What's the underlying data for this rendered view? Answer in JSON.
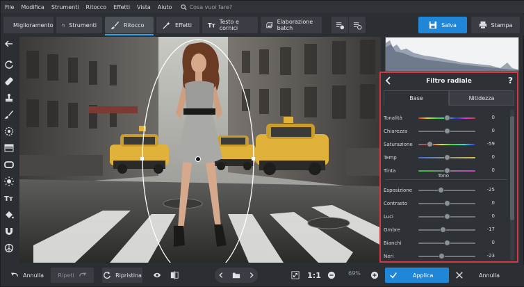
{
  "menu": [
    "File",
    "Modifica",
    "Strumenti",
    "Ritocco",
    "Effetti",
    "Vista",
    "Aiuto"
  ],
  "search_placeholder": "Cosa vuoi fare?",
  "tabs": [
    {
      "label": "Miglioramento",
      "icon": "sliders-icon"
    },
    {
      "label": "Strumenti",
      "icon": "crop-icon"
    },
    {
      "label": "Ritocco",
      "icon": "brush-icon"
    },
    {
      "label": "Effetti",
      "icon": "magic-wand-icon"
    },
    {
      "label": "Testo e cornici",
      "icon": "text-icon"
    },
    {
      "label": "Elaborazione batch",
      "icon": "batch-icon"
    }
  ],
  "save_label": "Salva",
  "print_label": "Stampa",
  "panel": {
    "title": "Filtro radiale",
    "help": "?",
    "tab_base": "Base",
    "tab_sharpness": "Nitidezza",
    "section_tone": "Tono",
    "sliders": [
      {
        "label": "Tonalità",
        "value": "0",
        "level": 0.5
      },
      {
        "label": "Chiarezza",
        "value": "0",
        "level": 0.5
      },
      {
        "label": "Saturazione",
        "value": "-59",
        "level": 0.2
      },
      {
        "label": "Temp",
        "value": "0",
        "level": 0.5
      },
      {
        "label": "Tinta",
        "value": "0",
        "level": 0.5
      },
      {
        "label": "Esposizione",
        "value": "-25",
        "level": 0.4
      },
      {
        "label": "Contrasto",
        "value": "0",
        "level": 0.5
      },
      {
        "label": "Luci",
        "value": "0",
        "level": 0.5
      },
      {
        "label": "Ombre",
        "value": "-17",
        "level": 0.43
      },
      {
        "label": "Bianchi",
        "value": "0",
        "level": 0.5
      },
      {
        "label": "Neri",
        "value": "-23",
        "level": 0.41
      }
    ]
  },
  "bottom": {
    "undo": "Annulla",
    "redo": "Ripeti",
    "reset": "Ripristina",
    "zoom_ratio": "1:1",
    "zoom_value": "69%",
    "apply": "Applica",
    "cancel": "Annulla"
  }
}
